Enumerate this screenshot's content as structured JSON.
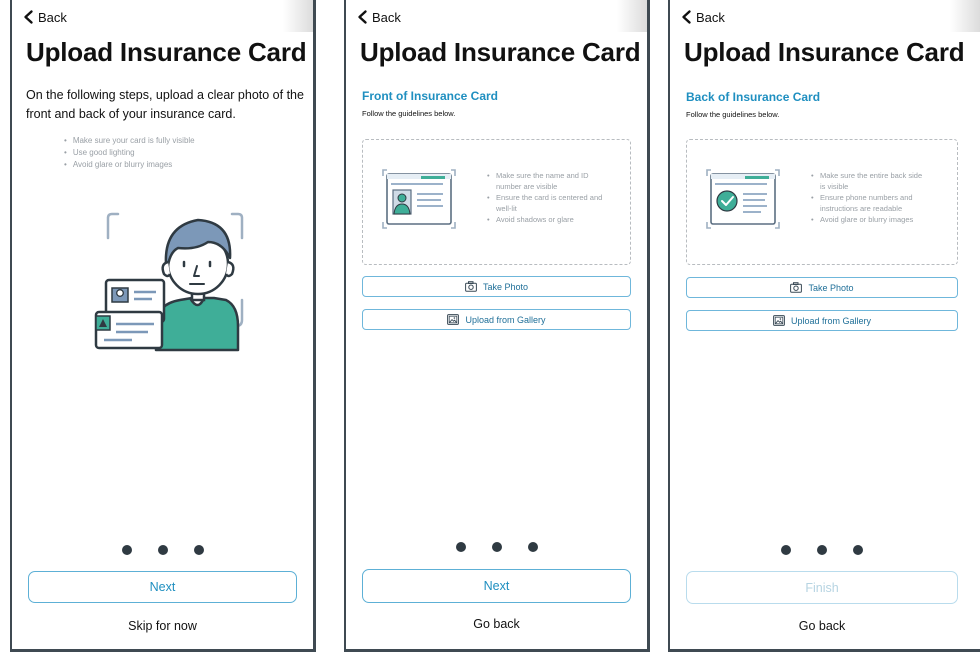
{
  "screens": [
    {
      "back_label": "Back",
      "title": "Upload Insurance Card",
      "intro": "On the following steps, upload a clear photo of the front and back of your insurance card.",
      "tips": [
        "Make sure your card is fully visible",
        "Use good lighting",
        "Avoid glare or blurry images"
      ],
      "primary_button": "Next",
      "secondary_link": "Skip for now"
    },
    {
      "back_label": "Back",
      "title": "Upload Insurance Card",
      "section_title": "Front of Insurance Card",
      "section_note": "Follow the guidelines below.",
      "guidelines": [
        "Make sure the name and ID number are visible",
        "Ensure the card is centered and well-lit",
        "Avoid shadows or glare"
      ],
      "take_photo": "Take Photo",
      "upload_gallery": "Upload from Gallery",
      "primary_button": "Next",
      "secondary_link": "Go back"
    },
    {
      "back_label": "Back",
      "title": "Upload Insurance Card",
      "section_title": "Back of Insurance Card",
      "section_note": "Follow the guidelines below.",
      "guidelines": [
        "Make sure the entire back side is visible",
        "Ensure phone numbers and instructions are readable",
        "Avoid glare or blurry images"
      ],
      "take_photo": "Take Photo",
      "upload_gallery": "Upload from Gallery",
      "primary_button": "Finish",
      "primary_disabled": true,
      "secondary_link": "Go back"
    }
  ],
  "colors": {
    "accent": "#1f8fc0",
    "border_accent": "#5db0d6",
    "dark": "#2f3a42",
    "illustration_teal": "#3fae98",
    "illustration_blue": "#7c98b8",
    "muted_text": "#9aa0a6"
  },
  "icons": [
    "chevron-left-icon",
    "camera-icon",
    "gallery-icon",
    "person-illustration",
    "id-card-icon",
    "check-circle-icon"
  ]
}
